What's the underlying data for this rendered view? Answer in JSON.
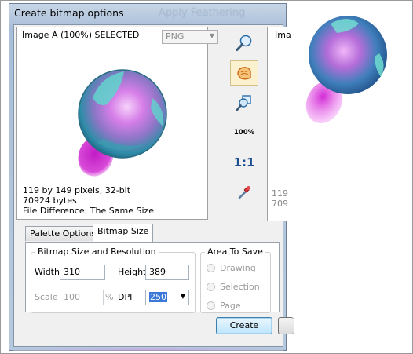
{
  "window": {
    "title": "Create bitmap options",
    "background_title": "Apply Feathering"
  },
  "image_a": {
    "label": "Image A (100%) SELECTED",
    "format": "PNG",
    "info": [
      "119 by 149 pixels, 32-bit",
      "70924 bytes",
      "File Difference: The Same Size"
    ]
  },
  "image_b": {
    "label_partial": "Ima",
    "info_partial": [
      "119",
      "709"
    ]
  },
  "tools": [
    {
      "name": "zoom-in-icon",
      "label": ""
    },
    {
      "name": "pan-hand-icon",
      "label": "",
      "selected": true
    },
    {
      "name": "zoom-out-icon",
      "label": ""
    },
    {
      "name": "zoom-100-button",
      "label": "100%"
    },
    {
      "name": "actual-size-button",
      "label": "1:1"
    },
    {
      "name": "color-picker-icon",
      "label": ""
    }
  ],
  "tabs": [
    {
      "label": "Palette Options",
      "active": false
    },
    {
      "label": "Bitmap Size",
      "active": true
    }
  ],
  "bitmap_size": {
    "group_label": "Bitmap Size and Resolution",
    "width_label": "Width",
    "width_value": "310",
    "height_label": "Height",
    "height_value": "389",
    "scale_label": "Scale",
    "scale_value": "100",
    "scale_unit": "%",
    "dpi_label": "DPI",
    "dpi_value": "250"
  },
  "area_to_save": {
    "group_label": "Area To Save",
    "options": [
      "Drawing",
      "Selection",
      "Page"
    ]
  },
  "buttons": {
    "create": "Create"
  },
  "colors": {
    "sphere_teal": "#2fa7b6",
    "sphere_pink": "#e8a6f0",
    "tail_magenta": "#c01fc4",
    "selection_blue": "#3b78d8"
  }
}
